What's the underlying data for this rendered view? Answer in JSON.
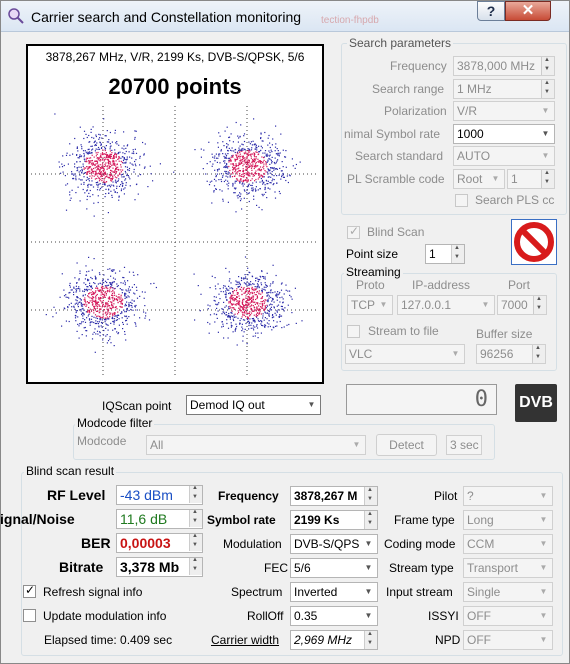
{
  "window": {
    "title": "Carrier search and Constellation monitoring",
    "help_label": "?",
    "close_label": "✕",
    "background_tab_text": "tection-fhpdb"
  },
  "plot": {
    "info": "3878,267 MHz, V/R, 2199 Ks, DVB-S/QPSK, 5/6",
    "points": "20700 points"
  },
  "search_params": {
    "title": "Search parameters",
    "frequency_label": "Frequency",
    "frequency_value": "3878,000 MHz",
    "search_range_label": "Search range",
    "search_range_value": "1 MHz",
    "polarization_label": "Polarization",
    "polarization_value": "V/R",
    "symbol_rate_label": "nimal Symbol rate",
    "symbol_rate_value": "1000",
    "search_standard_label": "Search standard",
    "search_standard_value": "AUTO",
    "pl_scramble_label": "PL Scramble code",
    "pl_scramble_value": "Root",
    "pl_scramble_num": "1",
    "search_pls_label": "Search PLS cc"
  },
  "blind_scan": {
    "label": "Blind Scan",
    "point_size_label": "Point size",
    "point_size_value": "1"
  },
  "streaming": {
    "title": "Streaming",
    "proto_label": "Proto",
    "ip_label": "IP-address",
    "port_label": "Port",
    "proto_value": "TCP",
    "ip_value": "127.0.0.1",
    "port_value": "7000",
    "stream_to_file_label": "Stream to file",
    "buffer_size_label": "Buffer size",
    "player_value": "VLC",
    "buffer_value": "96256"
  },
  "counter_value": "0",
  "dvb_logo": "DVB",
  "iqscan": {
    "label": "IQScan point",
    "value": "Demod IQ out"
  },
  "modcode": {
    "title": "Modcode filter",
    "label": "Modcode",
    "value": "All",
    "detect_label": "Detect",
    "sec_value": "3 sec"
  },
  "result": {
    "title": "Blind scan result",
    "rf_level_label": "RF Level",
    "rf_level_value": "-43 dBm",
    "snr_label": "ignal/Noise",
    "snr_value": "11,6 dB",
    "ber_label": "BER",
    "ber_value": "0,00003",
    "bitrate_label": "Bitrate",
    "bitrate_value": "3,378 Mb",
    "frequency_label": "Frequency",
    "frequency_value": "3878,267 M",
    "symbol_rate_label": "Symbol rate",
    "symbol_rate_value": "2199 Ks",
    "modulation_label": "Modulation",
    "modulation_value": "DVB-S/QPS",
    "fec_label": "FEC",
    "fec_value": "5/6",
    "spectrum_label": "Spectrum",
    "spectrum_value": "Inverted",
    "rolloff_label": "RollOff",
    "rolloff_value": "0.35",
    "carrier_width_label": "Carrier width",
    "carrier_width_value": "2,969 MHz",
    "pilot_label": "Pilot",
    "pilot_value": "?",
    "frame_type_label": "Frame type",
    "frame_type_value": "Long",
    "coding_mode_label": "Coding mode",
    "coding_mode_value": "CCM",
    "stream_type_label": "Stream type",
    "stream_type_value": "Transport",
    "input_stream_label": "Input stream",
    "input_stream_value": "Single",
    "issyi_label": "ISSYI",
    "issyi_value": "OFF",
    "npd_label": "NPD",
    "npd_value": "OFF",
    "refresh_label": "Refresh signal info",
    "update_mod_label": "Update modulation info",
    "elapsed_label": "Elapsed time: 0.409 sec"
  },
  "colors": {
    "rf_level": "#1a4fc4",
    "snr": "#1f7a1f",
    "ber": "#c81414",
    "constellation_core": "#d4185a",
    "constellation_edge": "#2a2aa8"
  }
}
